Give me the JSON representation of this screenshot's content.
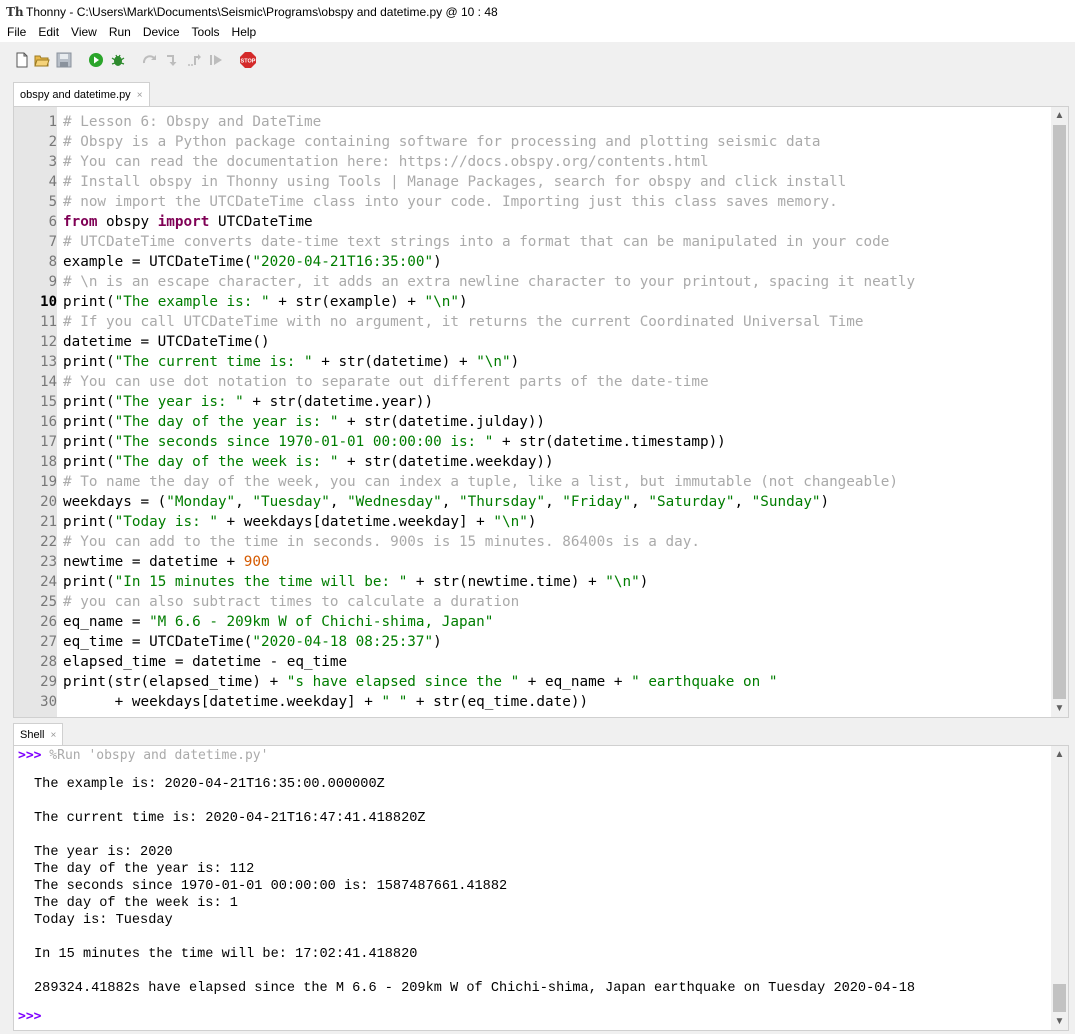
{
  "window": {
    "title": "Thonny  -  C:\\Users\\Mark\\Documents\\Seismic\\Programs\\obspy and datetime.py  @  10 : 48"
  },
  "menu": [
    "File",
    "Edit",
    "View",
    "Run",
    "Device",
    "Tools",
    "Help"
  ],
  "toolbar": {
    "icons": [
      "new-file-icon",
      "open-folder-icon",
      "save-icon",
      "run-icon",
      "debug-icon",
      "step-over-icon",
      "step-into-icon",
      "step-out-icon",
      "resume-icon",
      "stop-icon"
    ],
    "stop_label": "STOP"
  },
  "editor": {
    "tab": {
      "label": "obspy and datetime.py",
      "close": "×"
    },
    "current_line": 10,
    "line_numbers": [
      "1",
      "2",
      "3",
      "4",
      "5",
      "6",
      "7",
      "8",
      "9",
      "10",
      "11",
      "12",
      "13",
      "14",
      "15",
      "16",
      "17",
      "18",
      "19",
      "20",
      "21",
      "22",
      "23",
      "24",
      "25",
      "26",
      "27",
      "28",
      "29",
      "30"
    ],
    "lines": [
      [
        {
          "t": "# Lesson 6: Obspy and DateTime",
          "c": "cm"
        }
      ],
      [
        {
          "t": "# Obspy is a Python package containing software for processing and plotting seismic data",
          "c": "cm"
        }
      ],
      [
        {
          "t": "# You can read the documentation here: https://docs.obspy.org/contents.html",
          "c": "cm"
        }
      ],
      [
        {
          "t": "# Install obspy in Thonny using Tools | Manage Packages, search for obspy and click install",
          "c": "cm"
        }
      ],
      [
        {
          "t": "# now import the UTCDateTime class into your code. Importing just this class saves memory.",
          "c": "cm"
        }
      ],
      [
        {
          "t": "from",
          "c": "kw"
        },
        {
          "t": " obspy ",
          "c": ""
        },
        {
          "t": "import",
          "c": "kw"
        },
        {
          "t": " UTCDateTime",
          "c": ""
        }
      ],
      [
        {
          "t": "# UTCDateTime converts date-time text strings into a format that can be manipulated in your code",
          "c": "cm"
        }
      ],
      [
        {
          "t": "example = UTCDateTime(",
          "c": ""
        },
        {
          "t": "\"2020-04-21T16:35:00\"",
          "c": "st"
        },
        {
          "t": ")",
          "c": ""
        }
      ],
      [
        {
          "t": "# \\n is an escape character, it adds an extra newline character to your printout, spacing it neatly",
          "c": "cm"
        }
      ],
      [
        {
          "t": "print(",
          "c": ""
        },
        {
          "t": "\"The example is: \"",
          "c": "st"
        },
        {
          "t": " + str(example) + ",
          "c": ""
        },
        {
          "t": "\"\\n\"",
          "c": "st"
        },
        {
          "t": ")",
          "c": ""
        }
      ],
      [
        {
          "t": "# If you call UTCDateTime with no argument, it returns the current Coordinated Universal Time",
          "c": "cm"
        }
      ],
      [
        {
          "t": "datetime = UTCDateTime()",
          "c": ""
        }
      ],
      [
        {
          "t": "print(",
          "c": ""
        },
        {
          "t": "\"The current time is: \"",
          "c": "st"
        },
        {
          "t": " + str(datetime) + ",
          "c": ""
        },
        {
          "t": "\"\\n\"",
          "c": "st"
        },
        {
          "t": ")",
          "c": ""
        }
      ],
      [
        {
          "t": "# You can use dot notation to separate out different parts of the date-time",
          "c": "cm"
        }
      ],
      [
        {
          "t": "print(",
          "c": ""
        },
        {
          "t": "\"The year is: \"",
          "c": "st"
        },
        {
          "t": " + str(datetime.year))",
          "c": ""
        }
      ],
      [
        {
          "t": "print(",
          "c": ""
        },
        {
          "t": "\"The day of the year is: \"",
          "c": "st"
        },
        {
          "t": " + str(datetime.julday))",
          "c": ""
        }
      ],
      [
        {
          "t": "print(",
          "c": ""
        },
        {
          "t": "\"The seconds since 1970-01-01 00:00:00 is: \"",
          "c": "st"
        },
        {
          "t": " + str(datetime.timestamp))",
          "c": ""
        }
      ],
      [
        {
          "t": "print(",
          "c": ""
        },
        {
          "t": "\"The day of the week is: \"",
          "c": "st"
        },
        {
          "t": " + str(datetime.weekday))",
          "c": ""
        }
      ],
      [
        {
          "t": "# To name the day of the week, you can index a tuple, like a list, but immutable (not changeable)",
          "c": "cm"
        }
      ],
      [
        {
          "t": "weekdays = (",
          "c": ""
        },
        {
          "t": "\"Monday\"",
          "c": "st"
        },
        {
          "t": ", ",
          "c": ""
        },
        {
          "t": "\"Tuesday\"",
          "c": "st"
        },
        {
          "t": ", ",
          "c": ""
        },
        {
          "t": "\"Wednesday\"",
          "c": "st"
        },
        {
          "t": ", ",
          "c": ""
        },
        {
          "t": "\"Thursday\"",
          "c": "st"
        },
        {
          "t": ", ",
          "c": ""
        },
        {
          "t": "\"Friday\"",
          "c": "st"
        },
        {
          "t": ", ",
          "c": ""
        },
        {
          "t": "\"Saturday\"",
          "c": "st"
        },
        {
          "t": ", ",
          "c": ""
        },
        {
          "t": "\"Sunday\"",
          "c": "st"
        },
        {
          "t": ")",
          "c": ""
        }
      ],
      [
        {
          "t": "print(",
          "c": ""
        },
        {
          "t": "\"Today is: \"",
          "c": "st"
        },
        {
          "t": " + weekdays[datetime.weekday] + ",
          "c": ""
        },
        {
          "t": "\"\\n\"",
          "c": "st"
        },
        {
          "t": ")",
          "c": ""
        }
      ],
      [
        {
          "t": "# You can add to the time in seconds. 900s is 15 minutes. 86400s is a day.",
          "c": "cm"
        }
      ],
      [
        {
          "t": "newtime = datetime + ",
          "c": ""
        },
        {
          "t": "900",
          "c": "nm"
        }
      ],
      [
        {
          "t": "print(",
          "c": ""
        },
        {
          "t": "\"In 15 minutes the time will be: \"",
          "c": "st"
        },
        {
          "t": " + str(newtime.time) + ",
          "c": ""
        },
        {
          "t": "\"\\n\"",
          "c": "st"
        },
        {
          "t": ")",
          "c": ""
        }
      ],
      [
        {
          "t": "# you can also subtract times to calculate a duration",
          "c": "cm"
        }
      ],
      [
        {
          "t": "eq_name = ",
          "c": ""
        },
        {
          "t": "\"M 6.6 - 209km W of Chichi-shima, Japan\"",
          "c": "st"
        }
      ],
      [
        {
          "t": "eq_time = UTCDateTime(",
          "c": ""
        },
        {
          "t": "\"2020-04-18 08:25:37\"",
          "c": "st"
        },
        {
          "t": ")",
          "c": ""
        }
      ],
      [
        {
          "t": "elapsed_time = datetime - eq_time",
          "c": ""
        }
      ],
      [
        {
          "t": "print(str(elapsed_time) + ",
          "c": ""
        },
        {
          "t": "\"s have elapsed since the \"",
          "c": "st"
        },
        {
          "t": " + eq_name + ",
          "c": ""
        },
        {
          "t": "\" earthquake on \"",
          "c": "st"
        }
      ],
      [
        {
          "t": "      + weekdays[datetime.weekday] + ",
          "c": ""
        },
        {
          "t": "\" \"",
          "c": "st"
        },
        {
          "t": " + str(eq_time.date))",
          "c": ""
        }
      ]
    ]
  },
  "shell": {
    "tab": {
      "label": "Shell",
      "close": "×"
    },
    "prompt": ">>>",
    "run_command": " %Run 'obspy and datetime.py'",
    "output": [
      "The example is: 2020-04-21T16:35:00.000000Z",
      "",
      "The current time is: 2020-04-21T16:47:41.418820Z",
      "",
      "The year is: 2020",
      "The day of the year is: 112",
      "The seconds since 1970-01-01 00:00:00 is: 1587487661.41882",
      "The day of the week is: 1",
      "Today is: Tuesday",
      "",
      "In 15 minutes the time will be: 17:02:41.418820",
      "",
      "289324.41882s have elapsed since the M 6.6 - 209km W of Chichi-shima, Japan earthquake on Tuesday 2020-04-18",
      ""
    ]
  },
  "scroll_arrows": {
    "up": "▲",
    "down": "▼"
  }
}
